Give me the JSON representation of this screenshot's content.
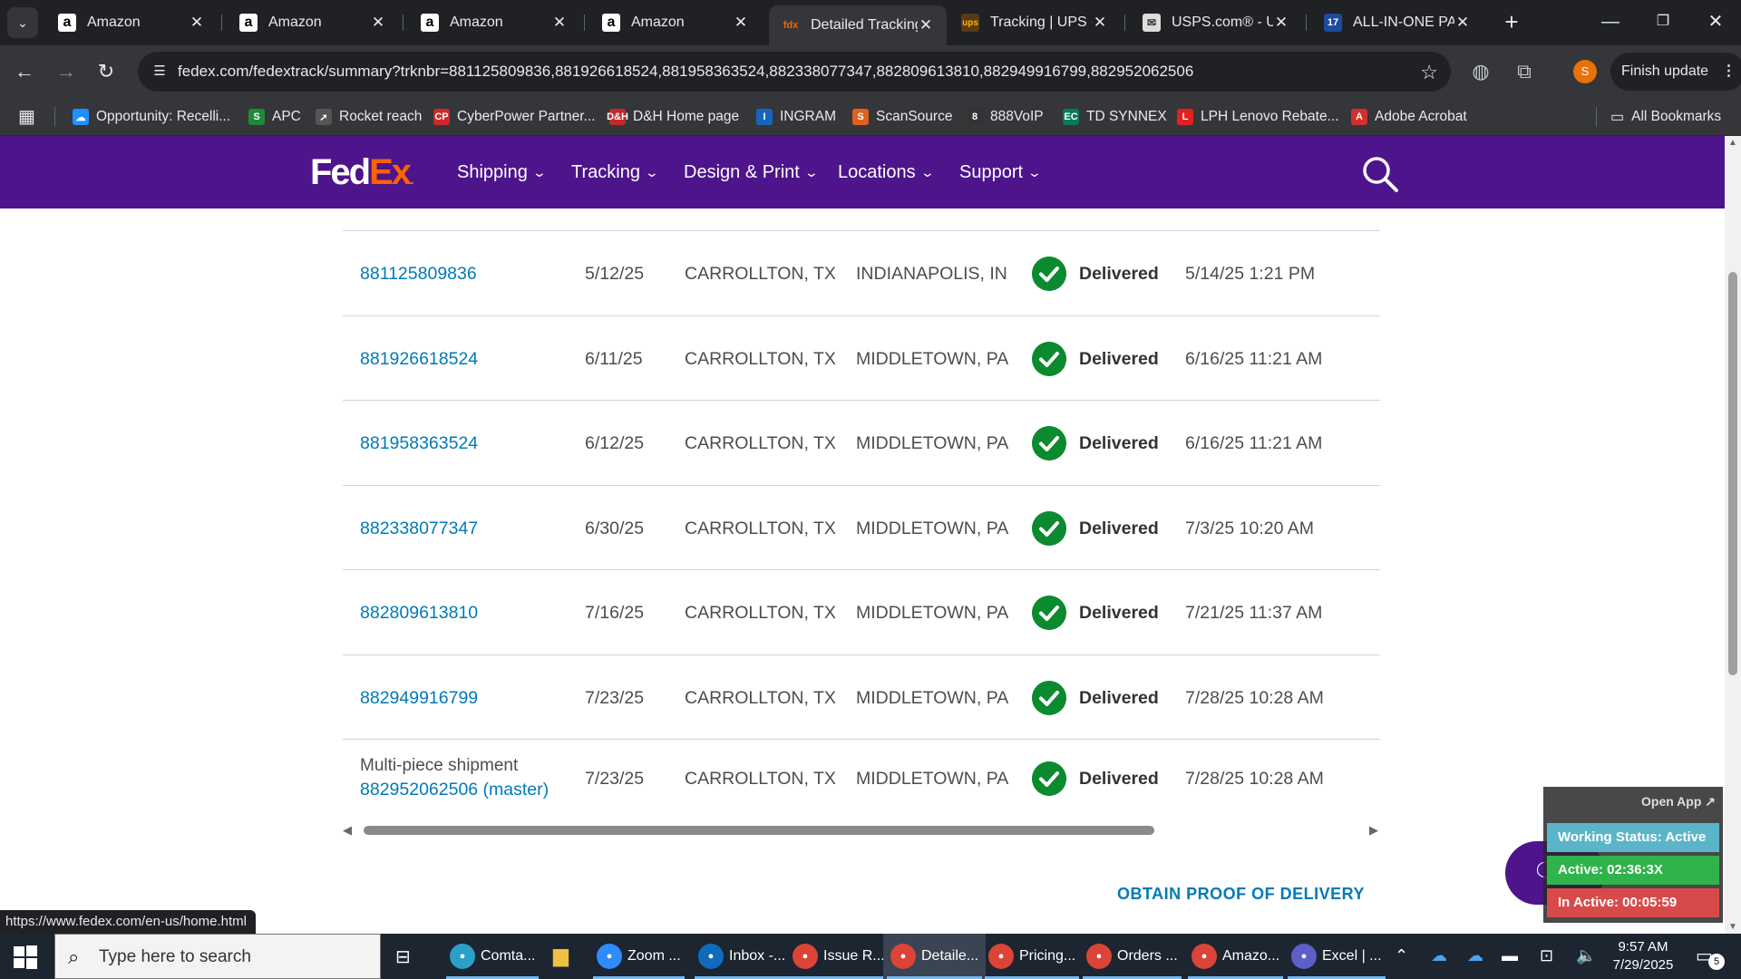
{
  "browser": {
    "tabs": [
      {
        "title": "Amazon",
        "icon": "amazon-icon"
      },
      {
        "title": "Amazon",
        "icon": "amazon-icon"
      },
      {
        "title": "Amazon",
        "icon": "amazon-icon"
      },
      {
        "title": "Amazon",
        "icon": "amazon-icon"
      },
      {
        "title": "Detailed Tracking",
        "icon": "fedex-icon",
        "active": true
      },
      {
        "title": "Tracking | UPS - U",
        "icon": "ups-icon"
      },
      {
        "title": "USPS.com® - US",
        "icon": "usps-icon"
      },
      {
        "title": "ALL-IN-ONE PAC",
        "icon": "17track-icon"
      }
    ],
    "url": "fedex.com/fedextrack/summary?trknbr=881125809836,881926618524,881958363524,882338077347,882809613810,882949916799,882952062506",
    "profile_initial": "S",
    "finish_update": "Finish update",
    "bookmarks": [
      {
        "label": "Opportunity: Recelli...",
        "color": "#1e90ff",
        "glyph": "☁"
      },
      {
        "label": "APC",
        "color": "#1f8a3b",
        "glyph": "S"
      },
      {
        "label": "Rocket reach",
        "color": "#555",
        "glyph": "➚"
      },
      {
        "label": "CyberPower Partner...",
        "color": "#d02828",
        "glyph": "CP"
      },
      {
        "label": "D&H Home page",
        "color": "#c62828",
        "glyph": "D&H"
      },
      {
        "label": "INGRAM",
        "color": "#1565c0",
        "glyph": "I"
      },
      {
        "label": "ScanSource",
        "color": "#e06020",
        "glyph": "S"
      },
      {
        "label": "888VoIP",
        "color": "#333",
        "glyph": "8"
      },
      {
        "label": "TD SYNNEX",
        "color": "#0a7a5a",
        "glyph": "EC"
      },
      {
        "label": "LPH Lenovo Rebate...",
        "color": "#e32020",
        "glyph": "L"
      },
      {
        "label": "Adobe Acrobat",
        "color": "#d32f2f",
        "glyph": "A"
      }
    ],
    "all_bookmarks": "All Bookmarks",
    "status_url": "https://www.fedex.com/en-us/home.html"
  },
  "fedex": {
    "logo_fed": "Fed",
    "logo_ex": "Ex",
    "logo_dot": ".",
    "nav": [
      "Shipping",
      "Tracking",
      "Design & Print",
      "Locations",
      "Support"
    ],
    "shipments": [
      {
        "tracking": "881125809836",
        "ship_date": "5/12/25",
        "origin": "CARROLLTON, TX",
        "destination": "INDIANAPOLIS, IN",
        "status": "Delivered",
        "delivered": "5/14/25 1:21 PM"
      },
      {
        "tracking": "881926618524",
        "ship_date": "6/11/25",
        "origin": "CARROLLTON, TX",
        "destination": "MIDDLETOWN, PA",
        "status": "Delivered",
        "delivered": "6/16/25 11:21 AM"
      },
      {
        "tracking": "881958363524",
        "ship_date": "6/12/25",
        "origin": "CARROLLTON, TX",
        "destination": "MIDDLETOWN, PA",
        "status": "Delivered",
        "delivered": "6/16/25 11:21 AM"
      },
      {
        "tracking": "882338077347",
        "ship_date": "6/30/25",
        "origin": "CARROLLTON, TX",
        "destination": "MIDDLETOWN, PA",
        "status": "Delivered",
        "delivered": "7/3/25 10:20 AM"
      },
      {
        "tracking": "882809613810",
        "ship_date": "7/16/25",
        "origin": "CARROLLTON, TX",
        "destination": "MIDDLETOWN, PA",
        "status": "Delivered",
        "delivered": "7/21/25 11:37 AM"
      },
      {
        "tracking": "882949916799",
        "ship_date": "7/23/25",
        "origin": "CARROLLTON, TX",
        "destination": "MIDDLETOWN, PA",
        "status": "Delivered",
        "delivered": "7/28/25 10:28 AM"
      }
    ],
    "multi_piece": {
      "label": "Multi-piece shipment",
      "tracking": "882952062506 (master)",
      "ship_date": "7/23/25",
      "origin": "CARROLLTON, TX",
      "destination": "MIDDLETOWN, PA",
      "status": "Delivered",
      "delivered": "7/28/25 10:28 AM"
    },
    "proof_of_delivery": "OBTAIN PROOF OF DELIVERY",
    "colors": {
      "purple": "#4d148c",
      "orange": "#ff6200",
      "link": "#007ab7",
      "check": "#0c8a2f"
    }
  },
  "widget": {
    "open_app": "Open App ↗",
    "working_status": "Working Status: Active",
    "active_time": "Active: 02:36:3X",
    "inactive_time": "In Active: 00:05:59"
  },
  "taskbar": {
    "search_placeholder": "Type here to search",
    "items": [
      {
        "label": "Comta...",
        "color": "#2aa0c8"
      },
      {
        "label": "Zoom ...",
        "color": "#2d8cff"
      },
      {
        "label": "Inbox -...",
        "color": "#0f6cbd"
      },
      {
        "label": "Issue R...",
        "color": "#db4437"
      },
      {
        "label": "Detaile...",
        "color": "#db4437",
        "active": true
      },
      {
        "label": "Pricing...",
        "color": "#db4437"
      },
      {
        "label": "Orders ...",
        "color": "#db4437"
      },
      {
        "label": "Amazo...",
        "color": "#db4437"
      },
      {
        "label": "Excel | ...",
        "color": "#5b5fc7"
      }
    ],
    "time": "9:57 AM",
    "date": "7/29/2025",
    "notifications": "5"
  }
}
